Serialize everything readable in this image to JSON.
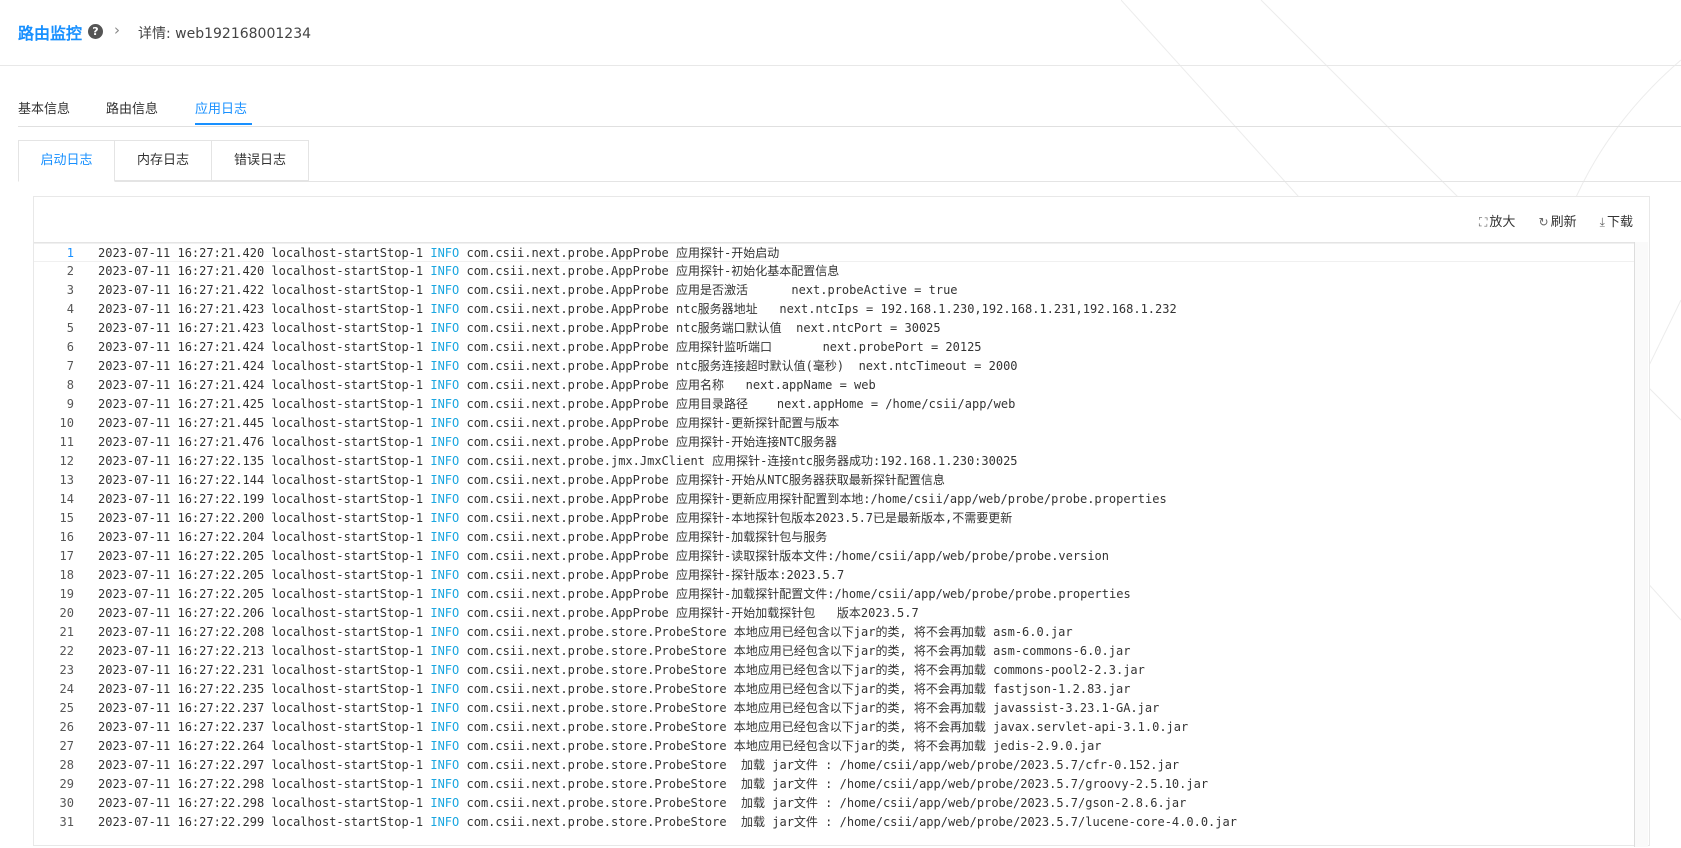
{
  "breadcrumb": {
    "root": "路由监控",
    "detail": "详情: web192168001234"
  },
  "top_tabs": [
    {
      "label": "基本信息"
    },
    {
      "label": "路由信息"
    },
    {
      "label": "应用日志",
      "active": true
    }
  ],
  "sub_tabs": [
    {
      "label": "启动日志",
      "active": true
    },
    {
      "label": "内存日志"
    },
    {
      "label": "错误日志"
    }
  ],
  "toolbar": {
    "zoom_label": "放大",
    "refresh_label": "刷新",
    "download_label": "下载"
  },
  "colors": {
    "accent": "#1890ff",
    "info_level": "#1aa6e0"
  },
  "log_lines": [
    {
      "no": "1",
      "ts": "2023-07-11 16:27:21.420",
      "thread": "localhost-startStop-1",
      "level": "INFO",
      "msg": " com.csii.next.probe.AppProbe 应用探针-开始启动"
    },
    {
      "no": "2",
      "ts": "2023-07-11 16:27:21.420",
      "thread": "localhost-startStop-1",
      "level": "INFO",
      "msg": " com.csii.next.probe.AppProbe 应用探针-初始化基本配置信息"
    },
    {
      "no": "3",
      "ts": "2023-07-11 16:27:21.422",
      "thread": "localhost-startStop-1",
      "level": "INFO",
      "msg": " com.csii.next.probe.AppProbe 应用是否激活      next.probeActive = true"
    },
    {
      "no": "4",
      "ts": "2023-07-11 16:27:21.423",
      "thread": "localhost-startStop-1",
      "level": "INFO",
      "msg": " com.csii.next.probe.AppProbe ntc服务器地址   next.ntcIps = 192.168.1.230,192.168.1.231,192.168.1.232"
    },
    {
      "no": "5",
      "ts": "2023-07-11 16:27:21.423",
      "thread": "localhost-startStop-1",
      "level": "INFO",
      "msg": " com.csii.next.probe.AppProbe ntc服务端口默认值  next.ntcPort = 30025"
    },
    {
      "no": "6",
      "ts": "2023-07-11 16:27:21.424",
      "thread": "localhost-startStop-1",
      "level": "INFO",
      "msg": " com.csii.next.probe.AppProbe 应用探针监听端口       next.probePort = 20125"
    },
    {
      "no": "7",
      "ts": "2023-07-11 16:27:21.424",
      "thread": "localhost-startStop-1",
      "level": "INFO",
      "msg": " com.csii.next.probe.AppProbe ntc服务连接超时默认值(毫秒)  next.ntcTimeout = 2000"
    },
    {
      "no": "8",
      "ts": "2023-07-11 16:27:21.424",
      "thread": "localhost-startStop-1",
      "level": "INFO",
      "msg": " com.csii.next.probe.AppProbe 应用名称   next.appName = web"
    },
    {
      "no": "9",
      "ts": "2023-07-11 16:27:21.425",
      "thread": "localhost-startStop-1",
      "level": "INFO",
      "msg": " com.csii.next.probe.AppProbe 应用目录路径    next.appHome = /home/csii/app/web"
    },
    {
      "no": "10",
      "ts": "2023-07-11 16:27:21.445",
      "thread": "localhost-startStop-1",
      "level": "INFO",
      "msg": " com.csii.next.probe.AppProbe 应用探针-更新探针配置与版本"
    },
    {
      "no": "11",
      "ts": "2023-07-11 16:27:21.476",
      "thread": "localhost-startStop-1",
      "level": "INFO",
      "msg": " com.csii.next.probe.AppProbe 应用探针-开始连接NTC服务器"
    },
    {
      "no": "12",
      "ts": "2023-07-11 16:27:22.135",
      "thread": "localhost-startStop-1",
      "level": "INFO",
      "msg": " com.csii.next.probe.jmx.JmxClient 应用探针-连接ntc服务器成功:192.168.1.230:30025"
    },
    {
      "no": "13",
      "ts": "2023-07-11 16:27:22.144",
      "thread": "localhost-startStop-1",
      "level": "INFO",
      "msg": " com.csii.next.probe.AppProbe 应用探针-开始从NTC服务器获取最新探针配置信息"
    },
    {
      "no": "14",
      "ts": "2023-07-11 16:27:22.199",
      "thread": "localhost-startStop-1",
      "level": "INFO",
      "msg": " com.csii.next.probe.AppProbe 应用探针-更新应用探针配置到本地:/home/csii/app/web/probe/probe.properties"
    },
    {
      "no": "15",
      "ts": "2023-07-11 16:27:22.200",
      "thread": "localhost-startStop-1",
      "level": "INFO",
      "msg": " com.csii.next.probe.AppProbe 应用探针-本地探针包版本2023.5.7已是最新版本,不需要更新"
    },
    {
      "no": "16",
      "ts": "2023-07-11 16:27:22.204",
      "thread": "localhost-startStop-1",
      "level": "INFO",
      "msg": " com.csii.next.probe.AppProbe 应用探针-加载探针包与服务"
    },
    {
      "no": "17",
      "ts": "2023-07-11 16:27:22.205",
      "thread": "localhost-startStop-1",
      "level": "INFO",
      "msg": " com.csii.next.probe.AppProbe 应用探针-读取探针版本文件:/home/csii/app/web/probe/probe.version"
    },
    {
      "no": "18",
      "ts": "2023-07-11 16:27:22.205",
      "thread": "localhost-startStop-1",
      "level": "INFO",
      "msg": " com.csii.next.probe.AppProbe 应用探针-探针版本:2023.5.7"
    },
    {
      "no": "19",
      "ts": "2023-07-11 16:27:22.205",
      "thread": "localhost-startStop-1",
      "level": "INFO",
      "msg": " com.csii.next.probe.AppProbe 应用探针-加载探针配置文件:/home/csii/app/web/probe/probe.properties"
    },
    {
      "no": "20",
      "ts": "2023-07-11 16:27:22.206",
      "thread": "localhost-startStop-1",
      "level": "INFO",
      "msg": " com.csii.next.probe.AppProbe 应用探针-开始加载探针包   版本2023.5.7"
    },
    {
      "no": "21",
      "ts": "2023-07-11 16:27:22.208",
      "thread": "localhost-startStop-1",
      "level": "INFO",
      "msg": " com.csii.next.probe.store.ProbeStore 本地应用已经包含以下jar的类, 将不会再加载 asm-6.0.jar"
    },
    {
      "no": "22",
      "ts": "2023-07-11 16:27:22.213",
      "thread": "localhost-startStop-1",
      "level": "INFO",
      "msg": " com.csii.next.probe.store.ProbeStore 本地应用已经包含以下jar的类, 将不会再加载 asm-commons-6.0.jar"
    },
    {
      "no": "23",
      "ts": "2023-07-11 16:27:22.231",
      "thread": "localhost-startStop-1",
      "level": "INFO",
      "msg": " com.csii.next.probe.store.ProbeStore 本地应用已经包含以下jar的类, 将不会再加载 commons-pool2-2.3.jar"
    },
    {
      "no": "24",
      "ts": "2023-07-11 16:27:22.235",
      "thread": "localhost-startStop-1",
      "level": "INFO",
      "msg": " com.csii.next.probe.store.ProbeStore 本地应用已经包含以下jar的类, 将不会再加载 fastjson-1.2.83.jar"
    },
    {
      "no": "25",
      "ts": "2023-07-11 16:27:22.237",
      "thread": "localhost-startStop-1",
      "level": "INFO",
      "msg": " com.csii.next.probe.store.ProbeStore 本地应用已经包含以下jar的类, 将不会再加载 javassist-3.23.1-GA.jar"
    },
    {
      "no": "26",
      "ts": "2023-07-11 16:27:22.237",
      "thread": "localhost-startStop-1",
      "level": "INFO",
      "msg": " com.csii.next.probe.store.ProbeStore 本地应用已经包含以下jar的类, 将不会再加载 javax.servlet-api-3.1.0.jar"
    },
    {
      "no": "27",
      "ts": "2023-07-11 16:27:22.264",
      "thread": "localhost-startStop-1",
      "level": "INFO",
      "msg": " com.csii.next.probe.store.ProbeStore 本地应用已经包含以下jar的类, 将不会再加载 jedis-2.9.0.jar"
    },
    {
      "no": "28",
      "ts": "2023-07-11 16:27:22.297",
      "thread": "localhost-startStop-1",
      "level": "INFO",
      "msg": " com.csii.next.probe.store.ProbeStore  加载 jar文件 : /home/csii/app/web/probe/2023.5.7/cfr-0.152.jar"
    },
    {
      "no": "29",
      "ts": "2023-07-11 16:27:22.298",
      "thread": "localhost-startStop-1",
      "level": "INFO",
      "msg": " com.csii.next.probe.store.ProbeStore  加载 jar文件 : /home/csii/app/web/probe/2023.5.7/groovy-2.5.10.jar"
    },
    {
      "no": "30",
      "ts": "2023-07-11 16:27:22.298",
      "thread": "localhost-startStop-1",
      "level": "INFO",
      "msg": " com.csii.next.probe.store.ProbeStore  加载 jar文件 : /home/csii/app/web/probe/2023.5.7/gson-2.8.6.jar"
    },
    {
      "no": "31",
      "ts": "2023-07-11 16:27:22.299",
      "thread": "localhost-startStop-1",
      "level": "INFO",
      "msg": " com.csii.next.probe.store.ProbeStore  加载 jar文件 : /home/csii/app/web/probe/2023.5.7/lucene-core-4.0.0.jar"
    }
  ]
}
